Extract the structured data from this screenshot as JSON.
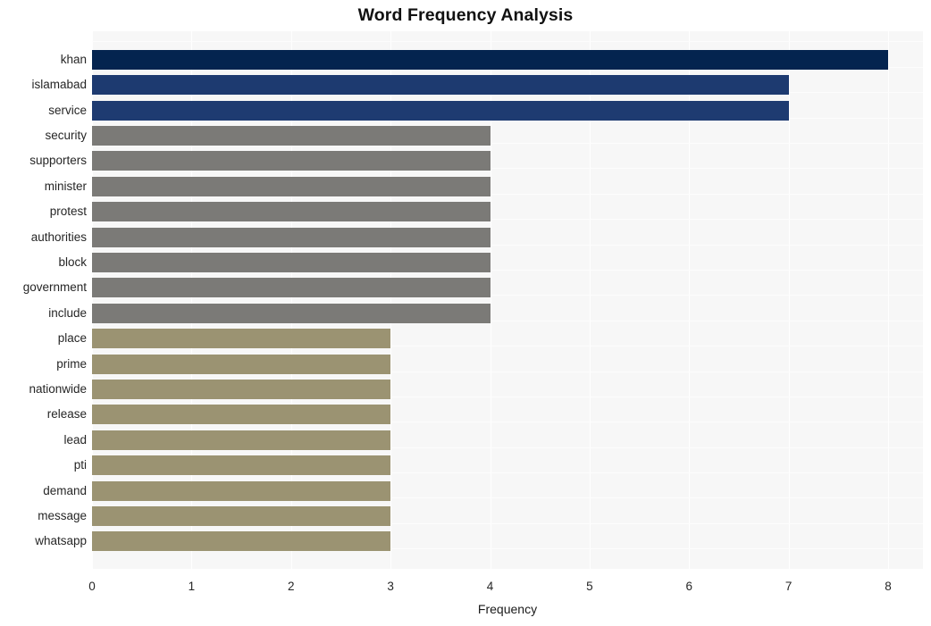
{
  "chart_data": {
    "type": "bar",
    "orientation": "horizontal",
    "title": "Word Frequency Analysis",
    "xlabel": "Frequency",
    "ylabel": "",
    "xlim": [
      0,
      8.35
    ],
    "xticks": [
      0,
      1,
      2,
      3,
      4,
      5,
      6,
      7,
      8
    ],
    "xtick_labels": [
      "0",
      "1",
      "2",
      "3",
      "4",
      "5",
      "6",
      "7",
      "8"
    ],
    "grid": true,
    "grid_color": "#ffffff",
    "plot_background": "#f7f7f7",
    "figure_background": "#ffffff",
    "legend": null,
    "categories": [
      "khan",
      "islamabad",
      "service",
      "security",
      "supporters",
      "minister",
      "protest",
      "authorities",
      "block",
      "government",
      "include",
      "place",
      "prime",
      "nationwide",
      "release",
      "lead",
      "pti",
      "demand",
      "message",
      "whatsapp"
    ],
    "values": [
      8,
      7,
      7,
      4,
      4,
      4,
      4,
      4,
      4,
      4,
      4,
      3,
      3,
      3,
      3,
      3,
      3,
      3,
      3,
      3
    ],
    "bar_colors": [
      "#04244f",
      "#1d3a70",
      "#1e3b71",
      "#7b7a77",
      "#7b7a77",
      "#7b7a77",
      "#7b7a77",
      "#7b7a77",
      "#7b7a77",
      "#7b7a77",
      "#7b7a77",
      "#9b9372",
      "#9b9372",
      "#9b9372",
      "#9b9372",
      "#9b9372",
      "#9b9372",
      "#9b9372",
      "#9b9372",
      "#9b9372"
    ]
  }
}
